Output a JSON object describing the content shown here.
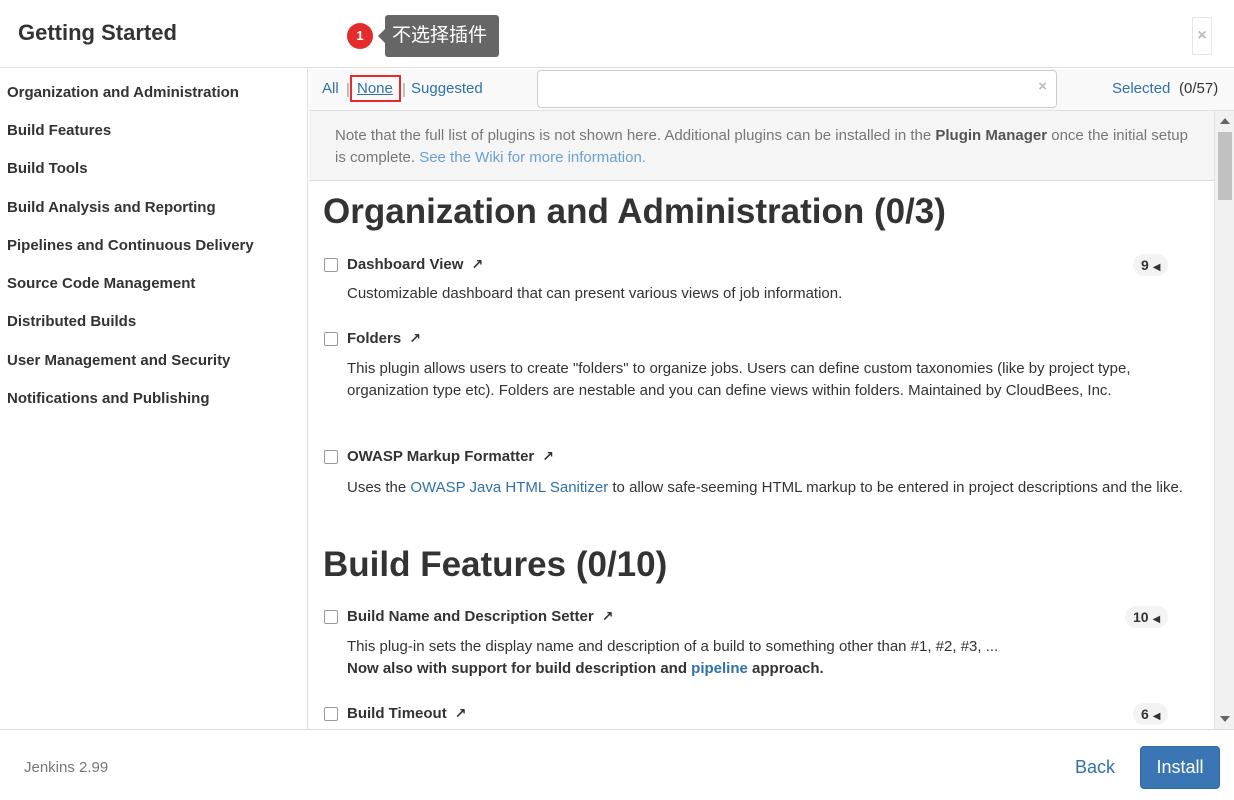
{
  "header": {
    "title": "Getting Started",
    "close_label": "×"
  },
  "callout": {
    "number": "1",
    "text": "不选择插件"
  },
  "sidebar": {
    "items": [
      {
        "label": "Organization and Administration"
      },
      {
        "label": "Build Features"
      },
      {
        "label": "Build Tools"
      },
      {
        "label": "Build Analysis and Reporting"
      },
      {
        "label": "Pipelines and Continuous Delivery"
      },
      {
        "label": "Source Code Management"
      },
      {
        "label": "Distributed Builds"
      },
      {
        "label": "User Management and Security"
      },
      {
        "label": "Notifications and Publishing"
      }
    ]
  },
  "toolbar": {
    "all_label": "All",
    "none_label": "None",
    "suggested_label": "Suggested",
    "separator": "|",
    "search_value": "",
    "clear_label": "×",
    "selected_label": "Selected",
    "selected_count": "(0/57)"
  },
  "notice": {
    "text_before": "Note that the full list of plugins is not shown here. Additional plugins can be installed in the ",
    "plugin_manager": "Plugin Manager",
    "text_after": " once the initial setup is complete. ",
    "link": "See the Wiki for more information."
  },
  "sections": [
    {
      "heading": "Organization and Administration (0/3)",
      "plugins": [
        {
          "name": "Dashboard View",
          "deps": "9",
          "description": "Customizable dashboard that can present various views of job information."
        },
        {
          "name": "Folders",
          "description": "This plugin allows users to create \"folders\" to organize jobs. Users can define custom taxonomies (like by project type, organization type etc). Folders are nestable and you can define views within folders. Maintained by CloudBees, Inc."
        },
        {
          "name": "OWASP Markup Formatter",
          "description_before": "Uses the ",
          "description_link": "OWASP Java HTML Sanitizer",
          "description_after": " to allow safe-seeming HTML markup to be entered in project descriptions and the like."
        }
      ]
    },
    {
      "heading": "Build Features (0/10)",
      "plugins": [
        {
          "name": "Build Name and Description Setter",
          "deps": "10",
          "description": "This plug-in sets the display name and description of a build to something other than #1, #2, #3, ...",
          "bold_before": "Now also with support for build description and ",
          "bold_link": "pipeline",
          "bold_after": " approach."
        },
        {
          "name": "Build Timeout",
          "deps": "6"
        }
      ]
    }
  ],
  "icons": {
    "external": "↗",
    "dep_caret": "◀"
  },
  "footer": {
    "version": "Jenkins 2.99",
    "back_label": "Back",
    "install_label": "Install"
  }
}
